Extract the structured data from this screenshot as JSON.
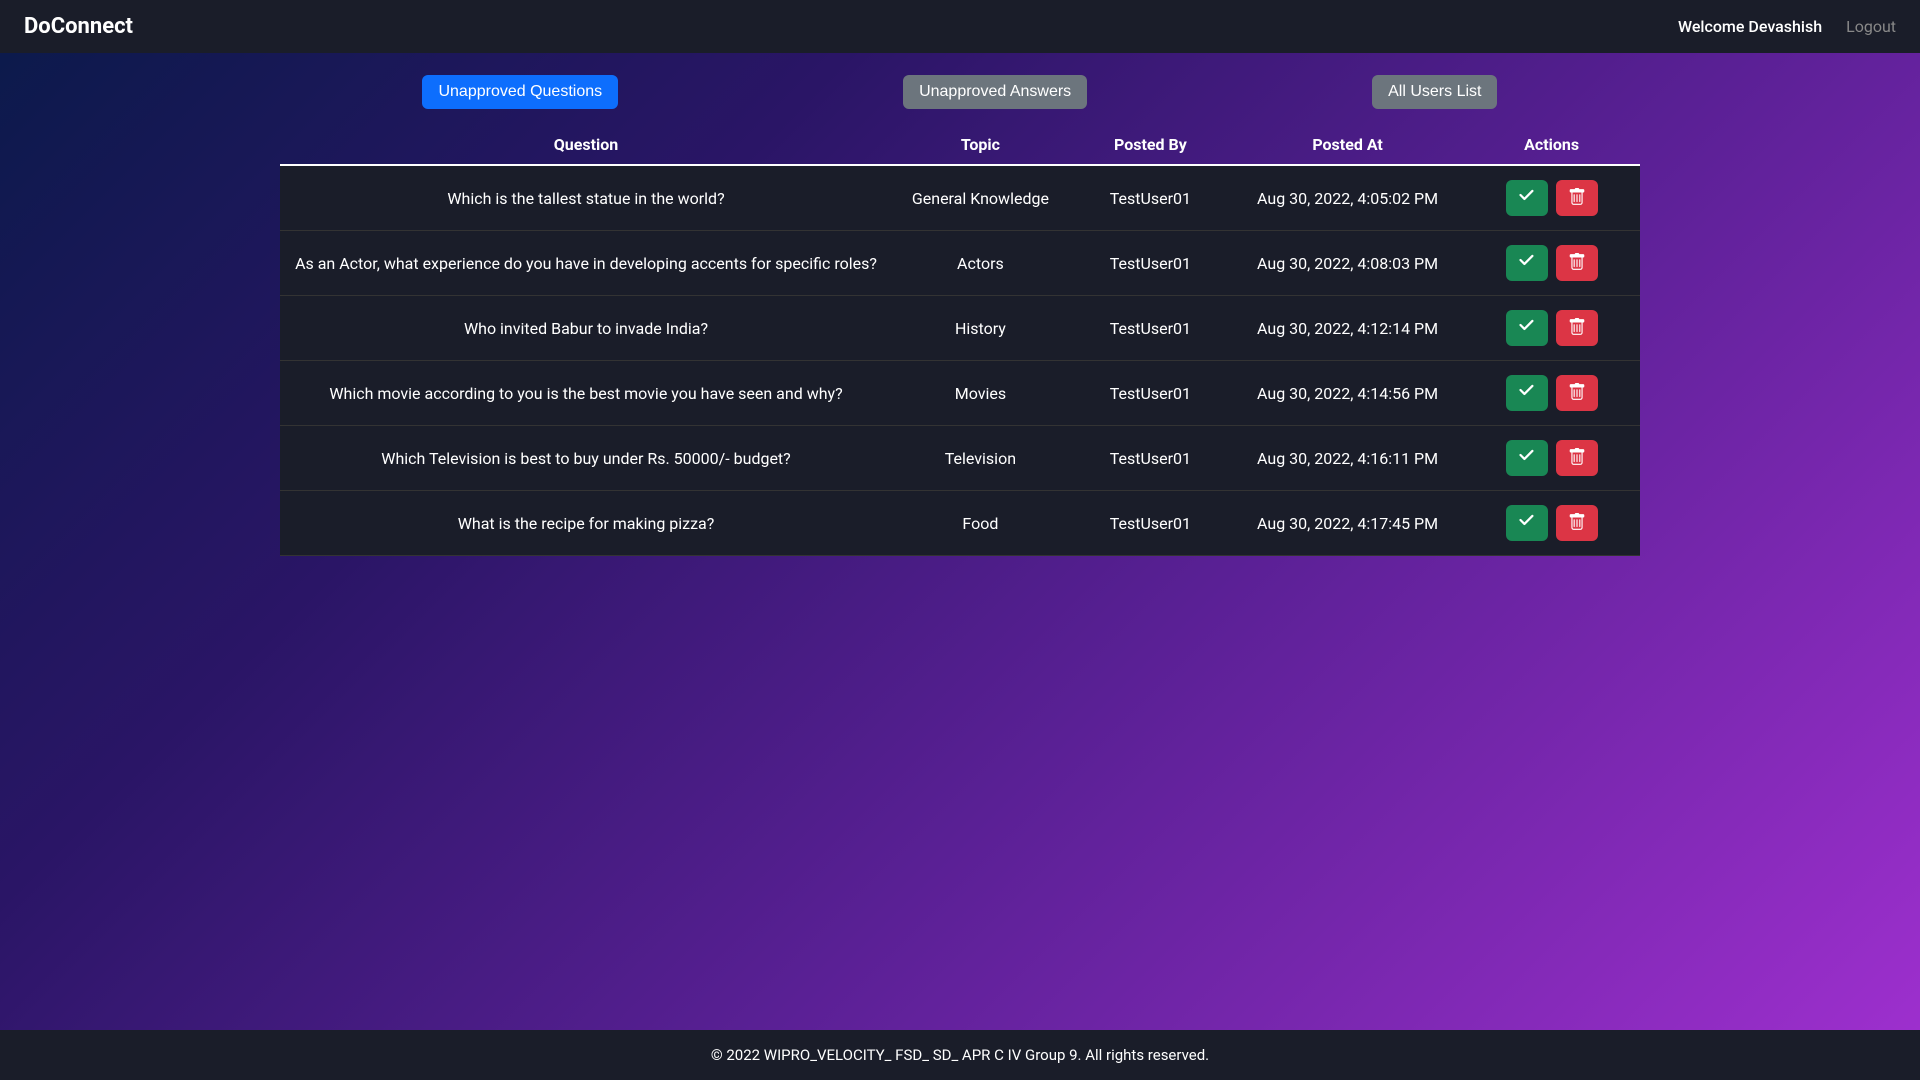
{
  "navbar": {
    "brand": "DoConnect",
    "welcome": "Welcome Devashish",
    "logout": "Logout"
  },
  "tabs": {
    "unapproved_questions": "Unapproved Questions",
    "unapproved_answers": "Unapproved Answers",
    "all_users": "All Users List"
  },
  "table": {
    "headers": {
      "question": "Question",
      "topic": "Topic",
      "posted_by": "Posted By",
      "posted_at": "Posted At",
      "actions": "Actions"
    },
    "rows": [
      {
        "question": "Which is the tallest statue in the world?",
        "topic": "General Knowledge",
        "posted_by": "TestUser01",
        "posted_at": "Aug 30, 2022, 4:05:02 PM"
      },
      {
        "question": "As an Actor, what experience do you have in developing accents for specific roles?",
        "topic": "Actors",
        "posted_by": "TestUser01",
        "posted_at": "Aug 30, 2022, 4:08:03 PM"
      },
      {
        "question": "Who invited Babur to invade India?",
        "topic": "History",
        "posted_by": "TestUser01",
        "posted_at": "Aug 30, 2022, 4:12:14 PM"
      },
      {
        "question": "Which movie according to you is the best movie you have seen and why?",
        "topic": "Movies",
        "posted_by": "TestUser01",
        "posted_at": "Aug 30, 2022, 4:14:56 PM"
      },
      {
        "question": "Which Television is best to buy under Rs. 50000/- budget?",
        "topic": "Television",
        "posted_by": "TestUser01",
        "posted_at": "Aug 30, 2022, 4:16:11 PM"
      },
      {
        "question": "What is the recipe for making pizza?",
        "topic": "Food",
        "posted_by": "TestUser01",
        "posted_at": "Aug 30, 2022, 4:17:45 PM"
      }
    ]
  },
  "footer": {
    "text": "© 2022 WIPRO_VELOCITY_ FSD_ SD_ APR C IV Group 9. All rights reserved."
  }
}
